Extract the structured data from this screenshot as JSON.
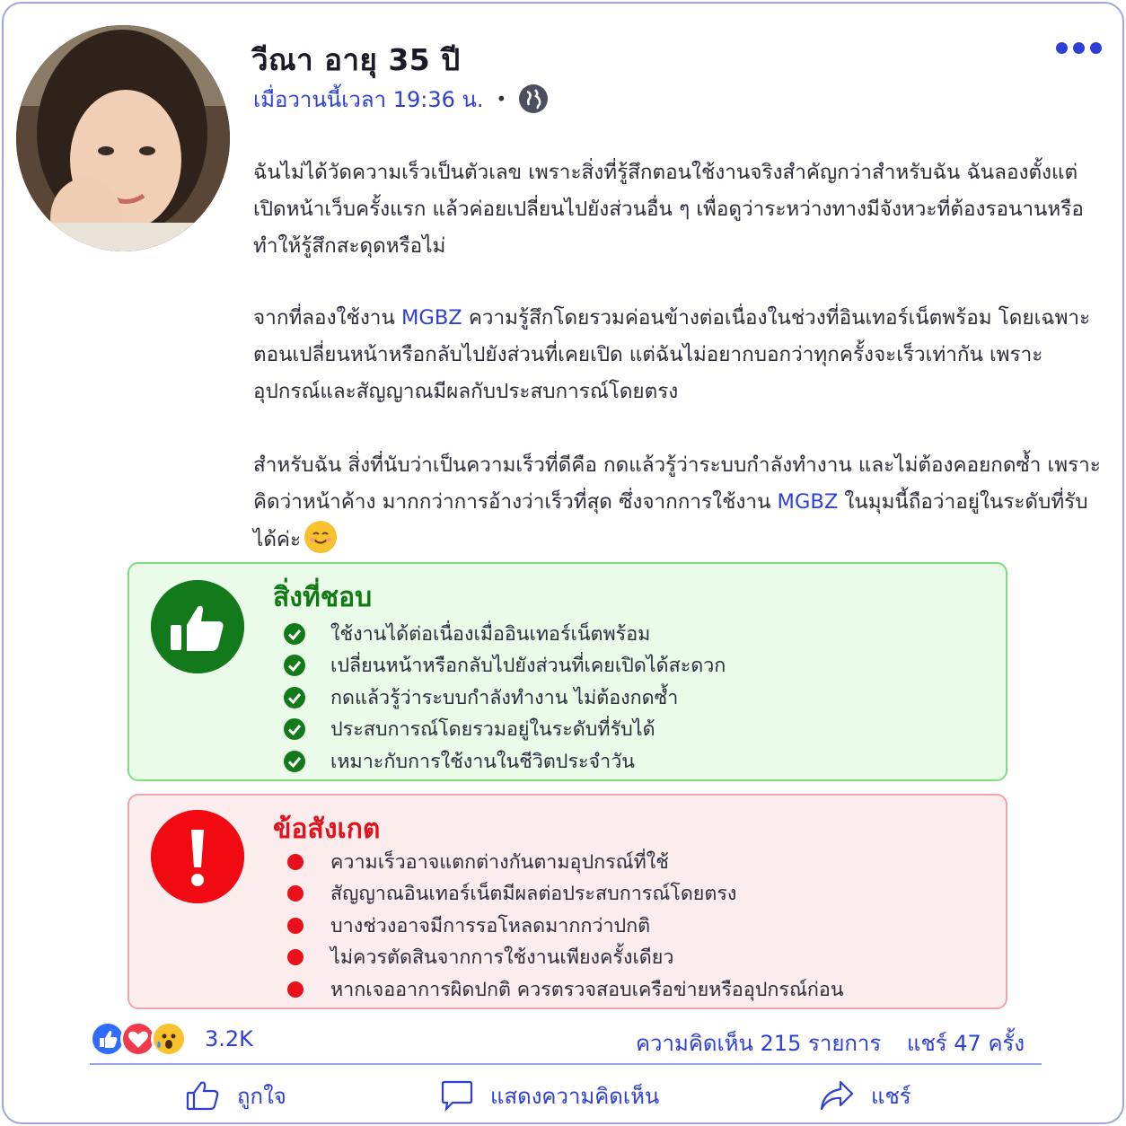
{
  "post": {
    "author_name": "วีณา อายุ 35 ปี",
    "timestamp": "เมื่อวานนี้เวลา 19:36 น.",
    "separator": "•",
    "privacy_icon": "globe-icon",
    "more_icon": "more-dots-icon"
  },
  "body": {
    "p1": "ฉันไม่ได้วัดความเร็วเป็นตัวเลข เพราะสิ่งที่รู้สึกตอนใช้งานจริงสำคัญกว่าสำหรับฉัน ฉันลองตั้งแต่เปิดหน้าเว็บครั้งแรก แล้วค่อยเปลี่ยนไปยังส่วนอื่น ๆ เพื่อดูว่าระหว่างทางมีจังหวะที่ต้องรอนานหรือทำให้รู้สึกสะดุดหรือไม่",
    "p2_before": "จากที่ลองใช้งาน ",
    "p2_brand": "MGBZ",
    "p2_after": " ความรู้สึกโดยรวมค่อนข้างต่อเนื่องในช่วงที่อินเทอร์เน็ตพร้อม โดยเฉพาะตอนเปลี่ยนหน้าหรือกลับไปยังส่วนที่เคยเปิด แต่ฉันไม่อยากบอกว่าทุกครั้งจะเร็วเท่ากัน เพราะอุปกรณ์และสัญญาณมีผลกับประสบการณ์โดยตรง",
    "p3_before": "สำหรับฉัน สิ่งที่นับว่าเป็นความเร็วที่ดีคือ กดแล้วรู้ว่าระบบกำลังทำงาน และไม่ต้องคอยกดซ้ำ เพราะคิดว่าหน้าค้าง มากกว่าการอ้างว่าเร็วที่สุด ซึ่งจากการใช้งาน ",
    "p3_brand": "MGBZ",
    "p3_after": " ในมุมนี้ถือว่าอยู่ในระดับที่รับได้ค่ะ",
    "emoji": "smiling-face-emoji"
  },
  "likes_box": {
    "title": "สิ่งที่ชอบ",
    "icon": "thumbs-up-icon",
    "items": [
      "ใช้งานได้ต่อเนื่องเมื่ออินเทอร์เน็ตพร้อม",
      "เปลี่ยนหน้าหรือกลับไปยังส่วนที่เคยเปิดได้สะดวก",
      "กดแล้วรู้ว่าระบบกำลังทำงาน ไม่ต้องกดซ้ำ",
      "ประสบการณ์โดยรวมอยู่ในระดับที่รับได้",
      "เหมาะกับการใช้งานในชีวิตประจำวัน"
    ],
    "color": "#127a1a"
  },
  "notes_box": {
    "title": "ข้อสังเกต",
    "icon": "exclamation-icon",
    "items": [
      "ความเร็วอาจแตกต่างกันตามอุปกรณ์ที่ใช้",
      "สัญญาณอินเทอร์เน็ตมีผลต่อประสบการณ์โดยตรง",
      "บางช่วงอาจมีการรอโหลดมากกว่าปกติ",
      "ไม่ควรตัดสินจากการใช้งานเพียงครั้งเดียว",
      "หากเจออาการผิดปกติ ควรตรวจสอบเครือข่ายหรืออุปกรณ์ก่อน"
    ],
    "color": "#e3101a"
  },
  "stats": {
    "reaction_icons": [
      "like-reaction-icon",
      "love-reaction-icon",
      "wow-reaction-icon"
    ],
    "reaction_count": "3.2K",
    "comment_count": "ความคิดเห็น 215 รายการ",
    "share_count": "แชร์  47 ครั้ง"
  },
  "actions": {
    "like": "ถูกใจ",
    "comment": "แสดงความคิดเห็น",
    "share": "แชร์"
  },
  "colors": {
    "accent": "#2d3fd6",
    "frame_border": "#9fa6dd"
  }
}
